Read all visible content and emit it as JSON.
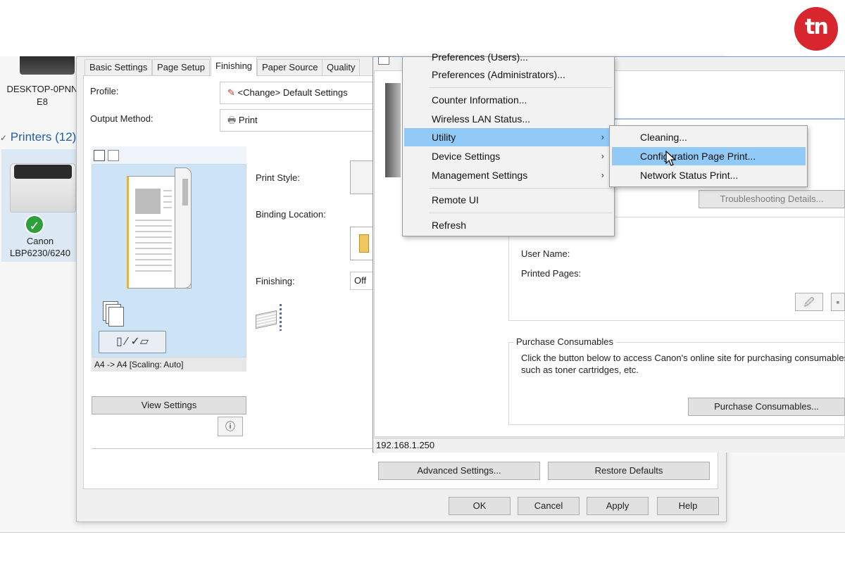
{
  "desktop": {
    "computer_name": "DESKTOP-0PNN",
    "computer_name_line2": "E8",
    "printers_header": "Printers (12)",
    "printer_line1": "Canon",
    "printer_line2": "LBP6230/6240"
  },
  "dialog": {
    "tabs": [
      {
        "label": "Basic Settings"
      },
      {
        "label": "Page Setup"
      },
      {
        "label": "Finishing"
      },
      {
        "label": "Paper Source"
      },
      {
        "label": "Quality"
      }
    ],
    "active_tab": "Finishing",
    "profile_label": "Profile:",
    "profile_value": "<Change> Default Settings",
    "output_method_label": "Output Method:",
    "output_method_value": "Print",
    "print_style_label": "Print Style:",
    "binding_location_label": "Binding Location:",
    "finishing_label": "Finishing:",
    "finishing_value": "Off",
    "preview_caption": "A4 -> A4 [Scaling: Auto]",
    "view_settings": "View Settings",
    "advanced_settings": "Advanced Settings...",
    "restore_defaults": "Restore Defaults",
    "ok": "OK",
    "cancel": "Cancel",
    "apply": "Apply",
    "help": "Help"
  },
  "status_window": {
    "troubleshooting": "Troubleshooting Details...",
    "user_name_label": "User Name:",
    "printed_pages_label": "Printed Pages:",
    "purchase_group_title": "Purchase Consumables",
    "purchase_text_line1": "Click the button below to access Canon's online site for purchasing consumables",
    "purchase_text_line2": "such as toner cartridges, etc.",
    "purchase_button": "Purchase Consumables...",
    "status_bar_ip": "192.168.1.250"
  },
  "context_menu": {
    "items": [
      {
        "label": "Preferences (Users)..."
      },
      {
        "label": "Preferences (Administrators)..."
      },
      {
        "label": "Counter Information..."
      },
      {
        "label": "Wireless LAN Status..."
      },
      {
        "label": "Utility"
      },
      {
        "label": "Device Settings"
      },
      {
        "label": "Management Settings"
      },
      {
        "label": "Remote UI"
      },
      {
        "label": "Refresh"
      }
    ],
    "highlighted": "Utility"
  },
  "submenu": {
    "items": [
      {
        "label": "Cleaning..."
      },
      {
        "label": "Configuration Page Print..."
      },
      {
        "label": "Network Status Print..."
      }
    ],
    "highlighted": "Configuration Page Print..."
  },
  "colors": {
    "highlight": "#91c9f7",
    "logo_red": "#d7262d",
    "preview_blue": "#cde3f6",
    "status_ok_green": "#2e9f3a"
  },
  "logo": {
    "text": "tn"
  }
}
